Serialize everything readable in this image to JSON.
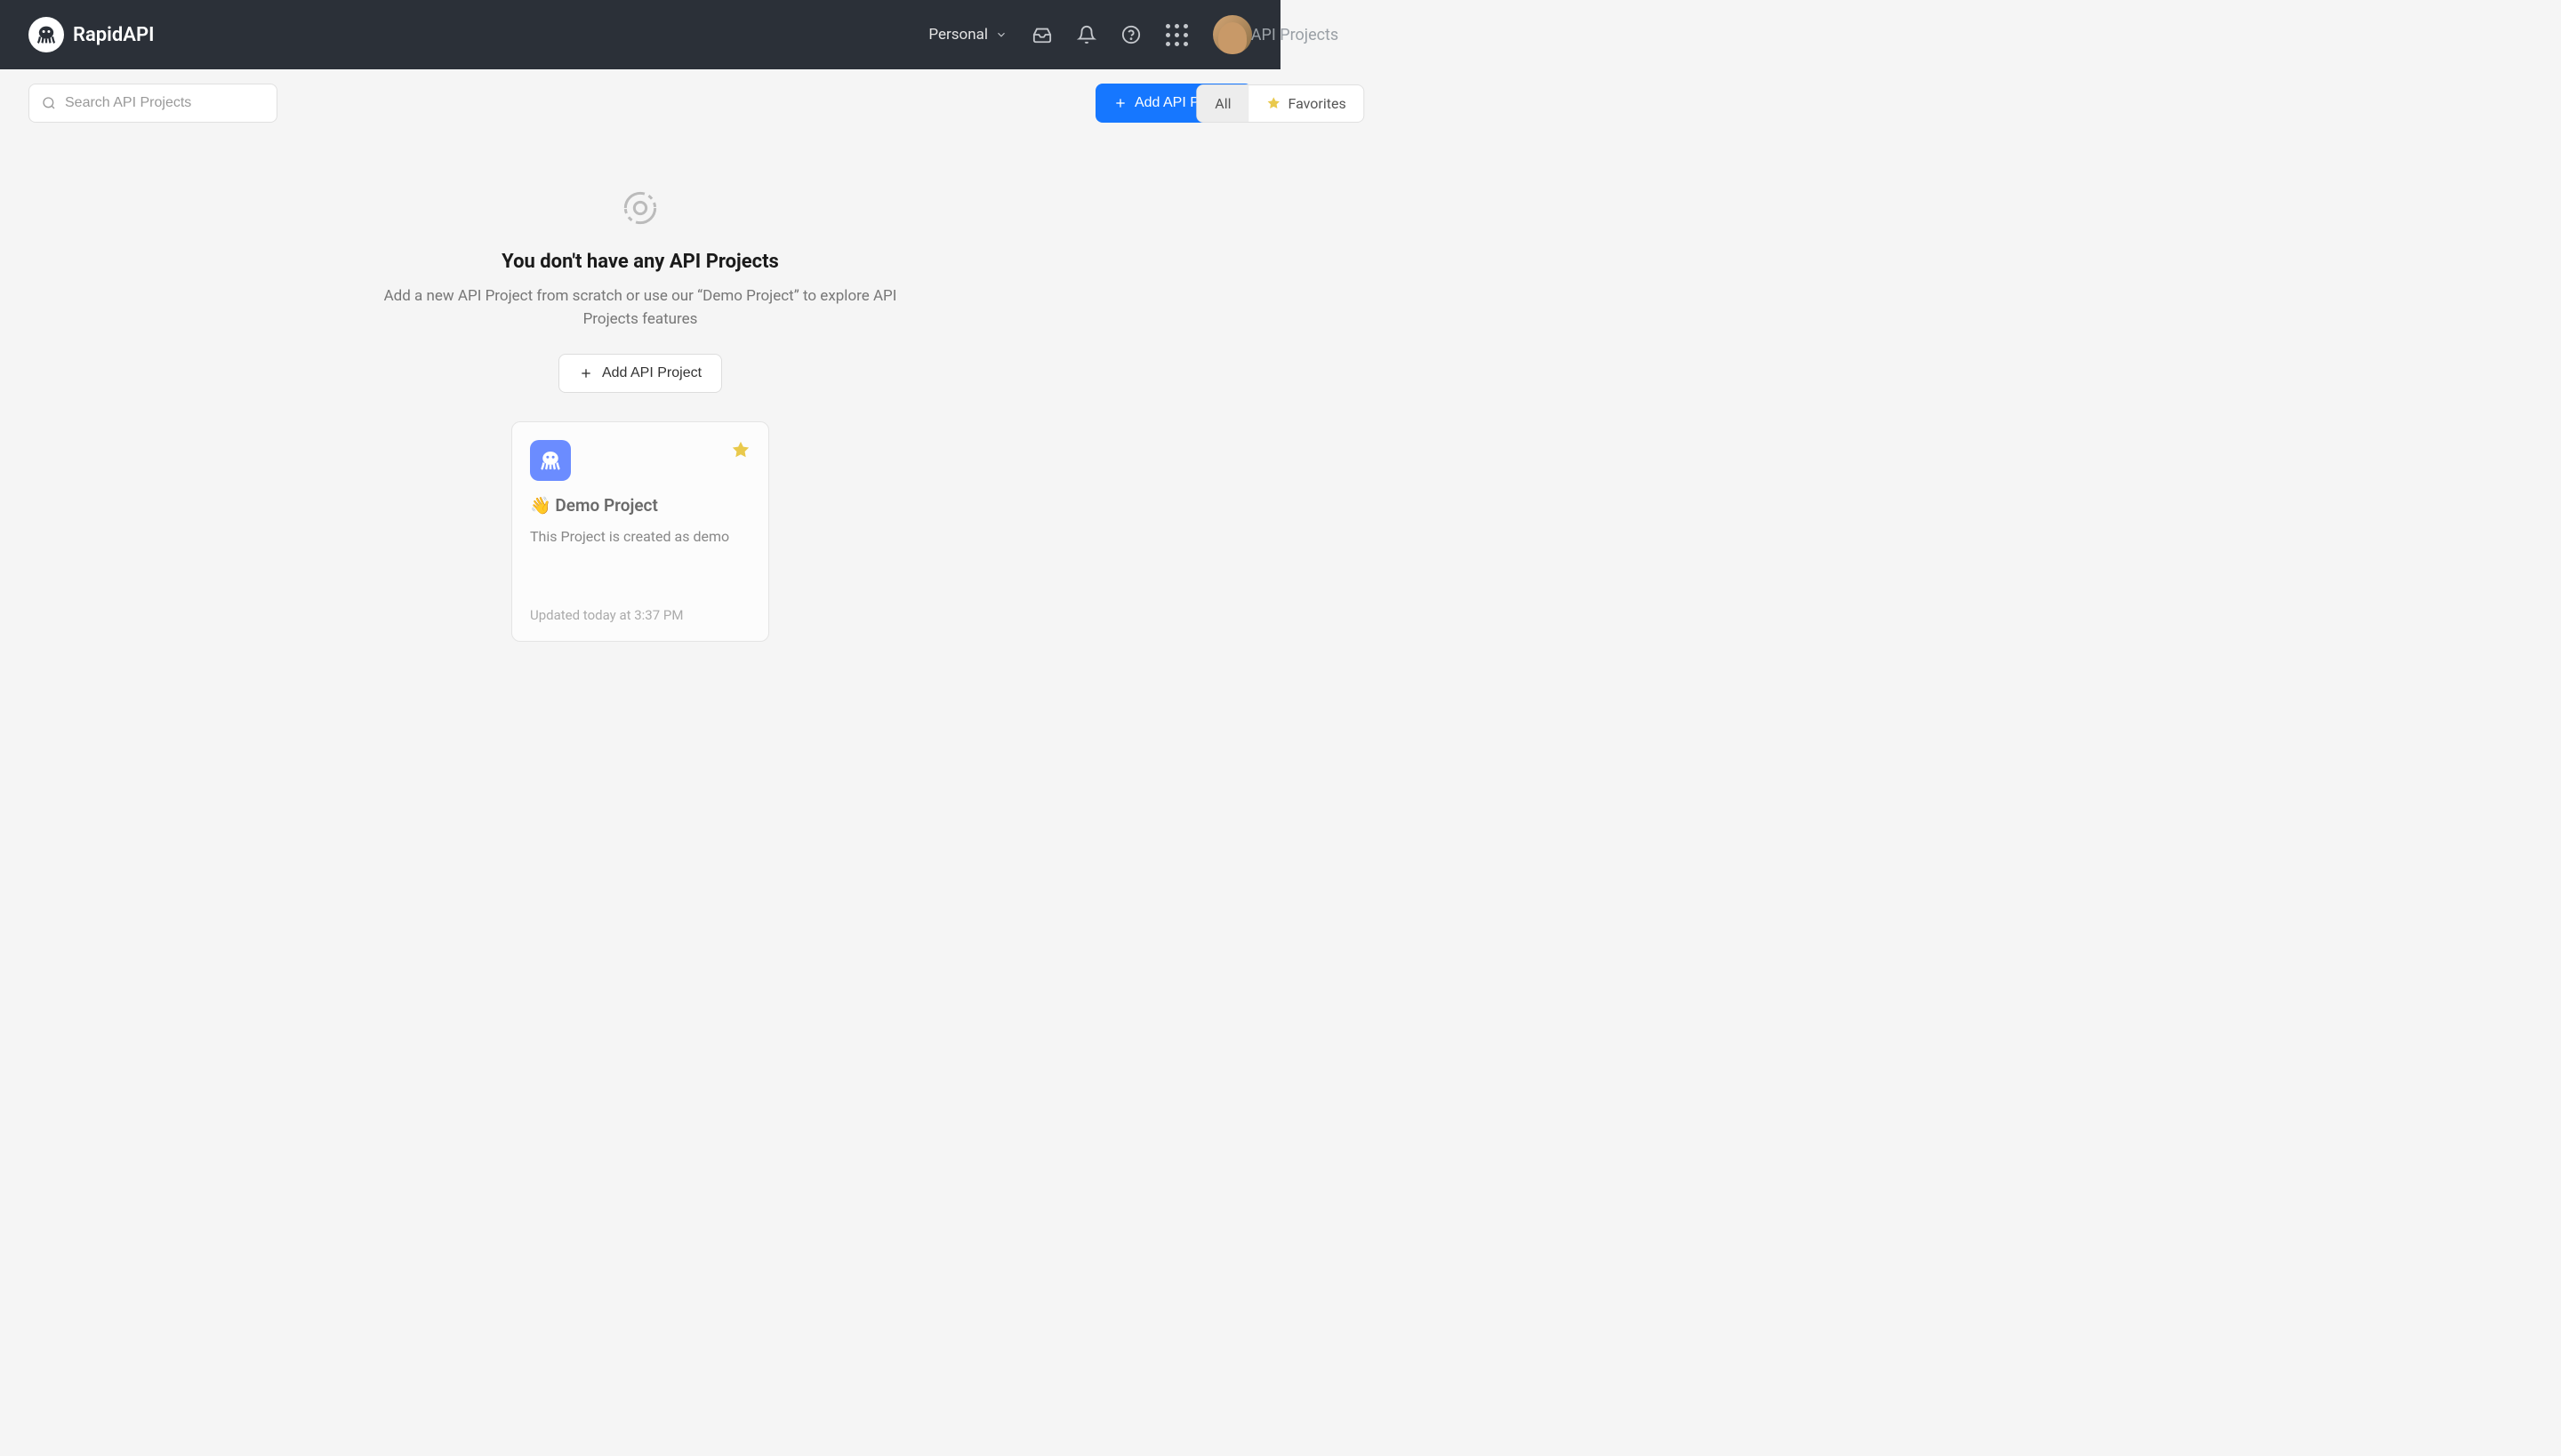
{
  "header": {
    "brand": "RapidAPI",
    "page_label": "API Projects",
    "workspace": "Personal"
  },
  "toolbar": {
    "search_placeholder": "Search API Projects",
    "tabs": {
      "all": "All",
      "favorites": "Favorites"
    },
    "add_button": "Add API Project"
  },
  "empty_state": {
    "title": "You don't have any API Projects",
    "description": "Add a new API Project from scratch or use our “Demo Project” to explore API Projects features",
    "add_button": "Add API Project"
  },
  "demo_card": {
    "title": "👋 Demo Project",
    "description": "This Project is created as demo",
    "updated": "Updated today at 3:37 PM"
  }
}
